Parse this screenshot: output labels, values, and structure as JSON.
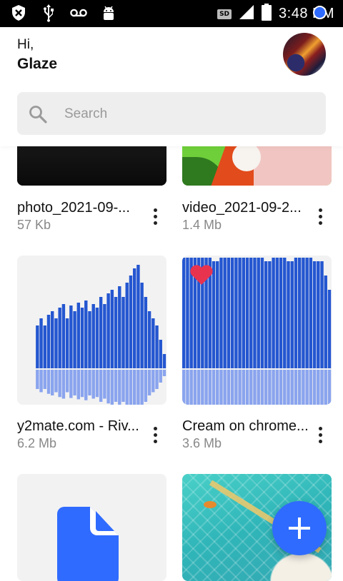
{
  "status_bar": {
    "time": "3:48 PM",
    "sd_label": "SD",
    "icons": [
      "shield-x-icon",
      "usb-icon",
      "voicemail-icon",
      "android-icon",
      "sd-card-icon",
      "signal-icon",
      "battery-icon"
    ]
  },
  "header": {
    "greeting": "Hi,",
    "user_name": "Glaze"
  },
  "search": {
    "placeholder": "Search"
  },
  "files": [
    {
      "name": "photo_2021-09-...",
      "size": "57 Kb",
      "thumb": "dark-photo"
    },
    {
      "name": "video_2021-09-2...",
      "size": "1.4 Mb",
      "thumb": "anime-video"
    },
    {
      "name": "y2mate.com - Riv...",
      "size": "6.2 Mb",
      "thumb": "audio-waveform"
    },
    {
      "name": "Cream on chrome...",
      "size": "3.6 Mb",
      "thumb": "audio-waveform",
      "favorite": true
    },
    {
      "name": "",
      "size": "",
      "thumb": "document-icon"
    },
    {
      "name": "",
      "size": "",
      "thumb": "pool-illustration"
    }
  ],
  "colors": {
    "accent": "#2f6bff",
    "favorite": "#e8334f",
    "wave": "#2456d0"
  }
}
